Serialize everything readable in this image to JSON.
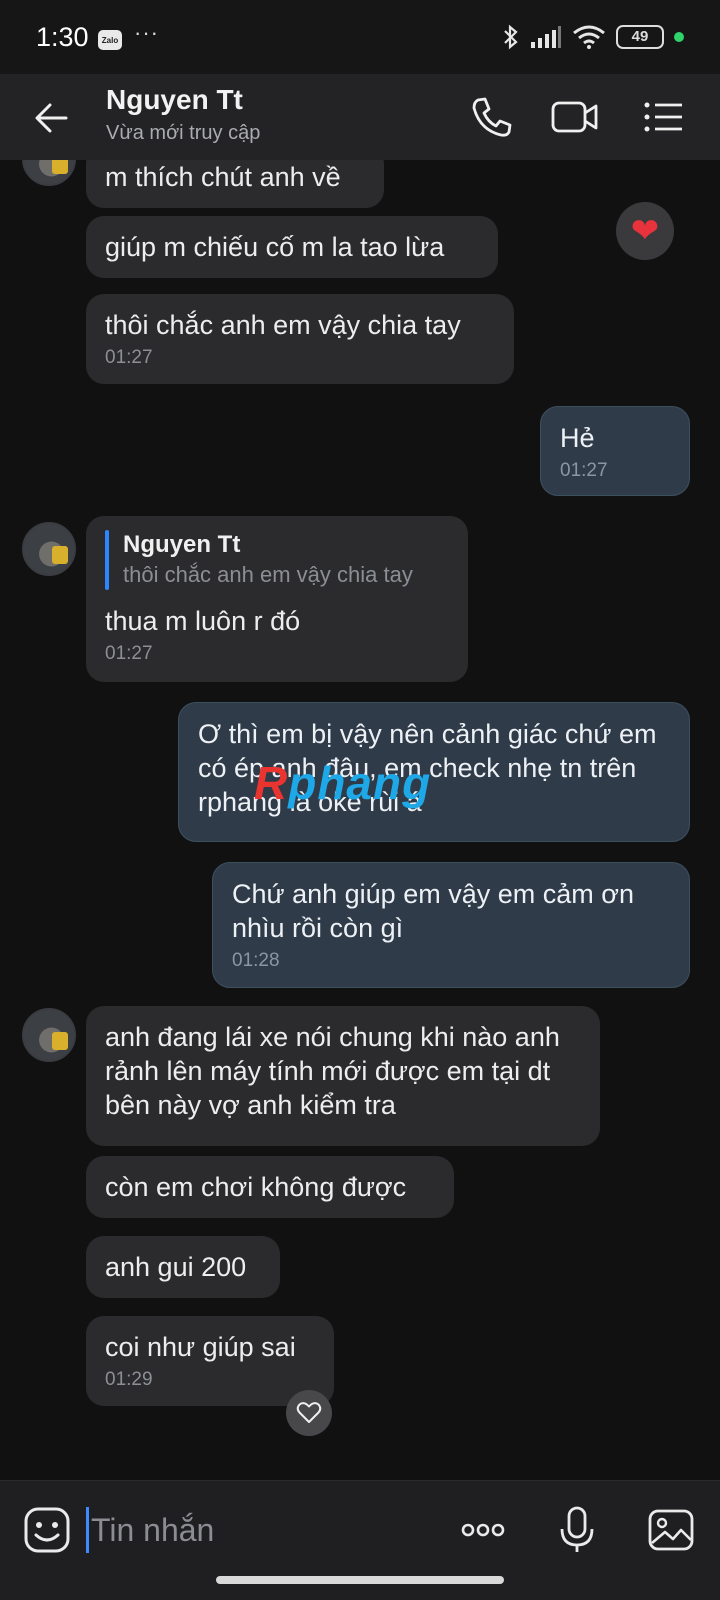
{
  "status_bar": {
    "time": "1:30",
    "app_chip": "Zalo",
    "more_dots": "···",
    "battery": "49"
  },
  "header": {
    "contact_name": "Nguyen Tt",
    "contact_status": "Vừa mới truy cập"
  },
  "messages": {
    "m1": {
      "text": "m thích chút anh về"
    },
    "m2": {
      "text": "giúp m chiếu cố m la tao lừa"
    },
    "m3": {
      "text": "thôi chắc anh em vậy chia tay",
      "time": "01:27"
    },
    "m4": {
      "text": "Hẻ",
      "time": "01:27"
    },
    "m5": {
      "quote_name": "Nguyen Tt",
      "quote_text": "thôi chắc anh em vậy chia tay",
      "text": "thua m luôn r đó",
      "time": "01:27"
    },
    "m6": {
      "text": "Ơ thì em bị vậy nên cảnh giác chứ em có ép anh đâu, em check nhẹ tn trên rphang là oke rùi á"
    },
    "m7": {
      "text": "Chứ anh giúp em vậy em cảm ơn nhìu rồi còn gì",
      "time": "01:28"
    },
    "m8": {
      "text": "anh đang lái xe nói chung khi nào anh rảnh lên máy tính mới được em tại dt bên này vợ anh kiểm tra"
    },
    "m9": {
      "text": "còn em chơi không được"
    },
    "m10": {
      "text": "anh gui 200"
    },
    "m11": {
      "text": "coi như giúp sai",
      "time": "01:29"
    }
  },
  "reactions": {
    "heart": "❤"
  },
  "watermark": {
    "first": "R",
    "rest": "phang"
  },
  "composer": {
    "placeholder": "Tin nhắn"
  },
  "colors": {
    "background": "#111112",
    "incoming_bubble": "#2b2b2d",
    "outgoing_bubble": "#2f3b48",
    "accent": "#2e86ff",
    "heart": "#e8323c"
  },
  "icons": {
    "header": [
      "back-arrow-icon",
      "phone-icon",
      "video-call-icon",
      "menu-list-icon"
    ],
    "composer": [
      "emoji-sticker-icon",
      "more-options-icon",
      "microphone-icon",
      "image-gallery-icon"
    ]
  }
}
